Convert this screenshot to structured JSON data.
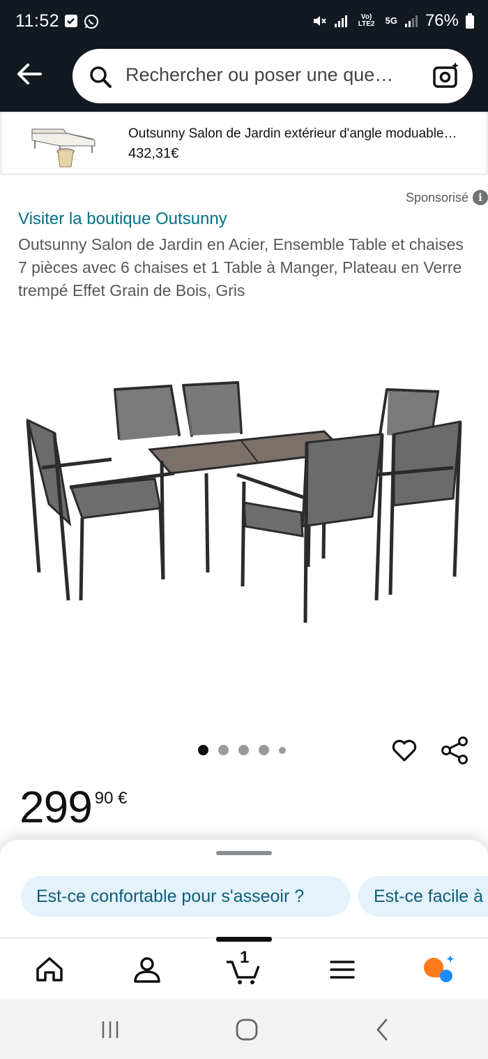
{
  "status_bar": {
    "time": "11:52",
    "battery": "76%",
    "network_1": "Vo) LTE2",
    "network_2": "5G"
  },
  "search": {
    "placeholder": "Rechercher ou poser une que…"
  },
  "promo": {
    "title": "Outsunny Salon de Jardin extérieur d'angle moduable…",
    "price": "432,31€"
  },
  "sponsored_label": "Sponsorisé",
  "store_link": "Visiter la boutique Outsunny",
  "product": {
    "title": "Outsunny Salon de Jardin en Acier, Ensemble Table et chaises 7 pièces avec 6 chaises et 1 Table à Manger, Plateau en Verre trempé Effet Grain de Bois, Gris",
    "price_whole": "299",
    "price_fraction": "90 €",
    "image_count": 5,
    "active_image": 1
  },
  "suggestions": [
    "Est-ce confortable pour s'asseoir ?",
    "Est-ce facile à"
  ],
  "nav": {
    "cart_count": "1",
    "items": [
      "home-icon",
      "account-icon",
      "cart-icon",
      "menu-icon",
      "rufus-icon"
    ]
  },
  "colors": {
    "header_bg": "#131921",
    "link": "#007185",
    "chip_bg": "#e3f2fb",
    "rufus_orange": "#ff7a1a",
    "rufus_blue": "#1a8cff"
  }
}
